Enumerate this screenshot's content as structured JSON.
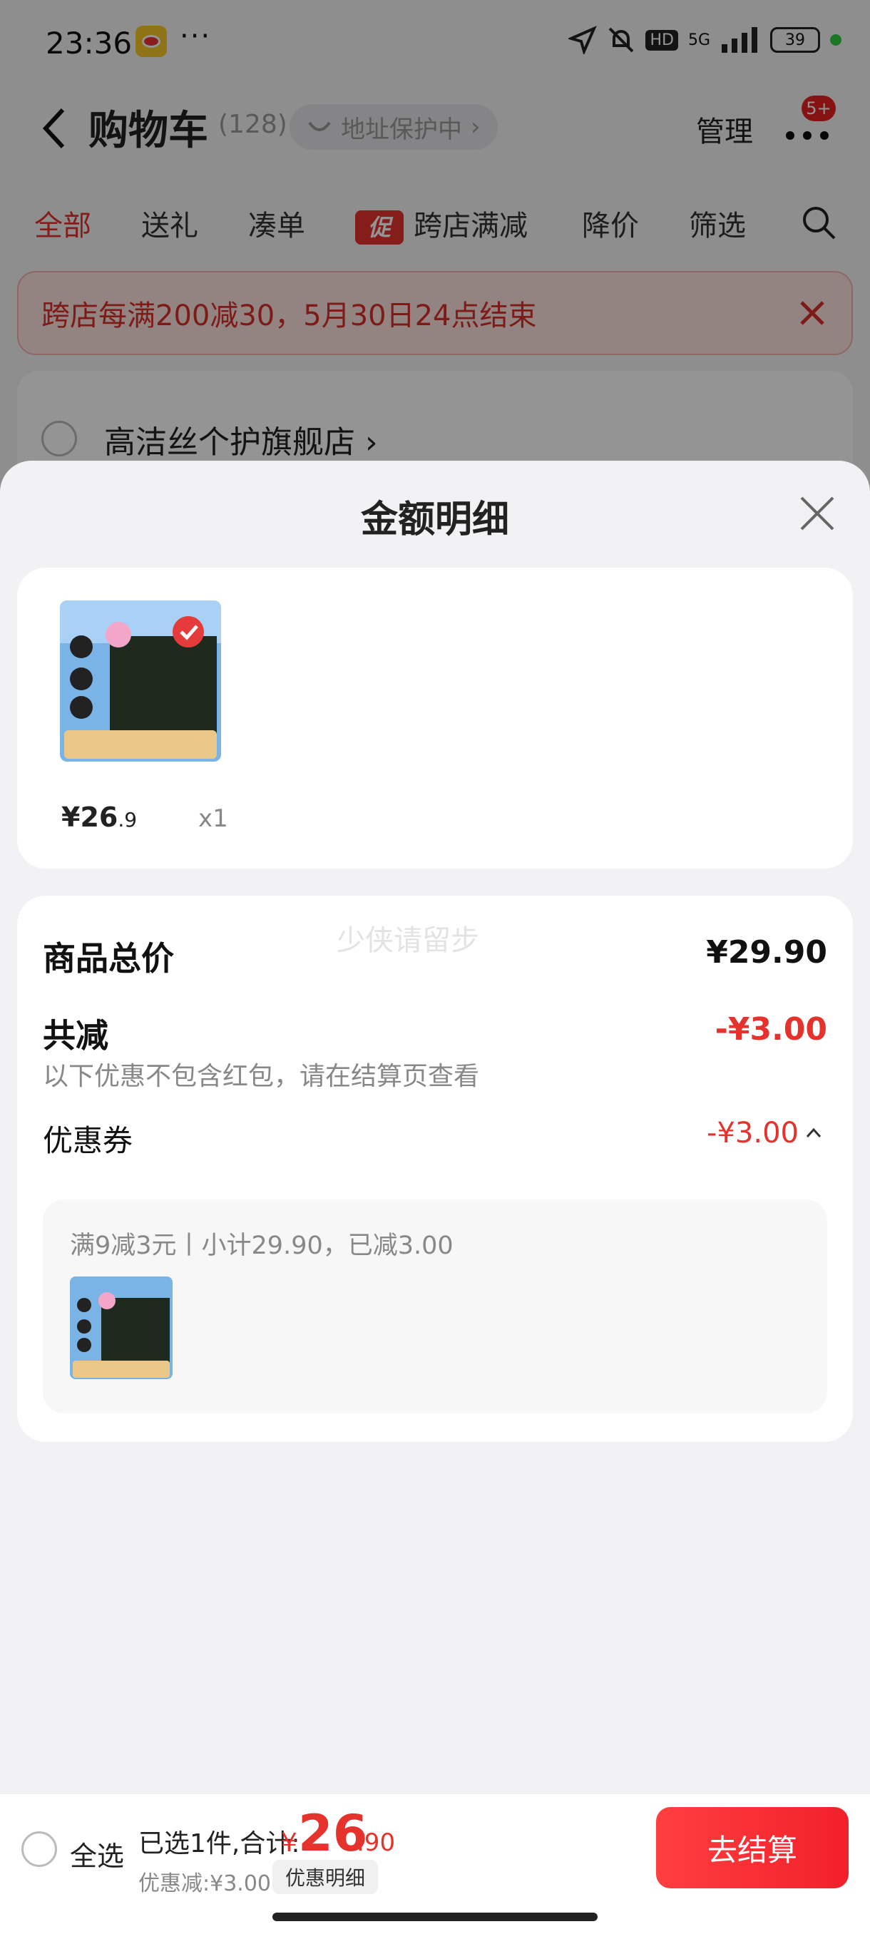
{
  "status_bar": {
    "time": "23:36",
    "more": "···",
    "battery": "39",
    "network": "5G"
  },
  "nav": {
    "title": "购物车",
    "count": "(128)",
    "address_status": "地址保护中",
    "manage": "管理",
    "more_badge": "5+"
  },
  "tabs": [
    {
      "label": "全部",
      "active": true
    },
    {
      "label": "送礼"
    },
    {
      "label": "凑单"
    },
    {
      "label": "跨店满减",
      "tag": "促"
    },
    {
      "label": "降价"
    },
    {
      "label": "筛选"
    }
  ],
  "banner": {
    "text": "跨店每满200减30，5月30日24点结束"
  },
  "store": {
    "name": "高洁丝个护旗舰店"
  },
  "sheet": {
    "title": "金额明细",
    "item": {
      "price_int": "¥26",
      "price_dec": ".9",
      "qty": "x1"
    },
    "summary": {
      "watermark": "少侠请留步",
      "total_label": "商品总价",
      "total_value": "¥29.90",
      "discount_label": "共减",
      "discount_value": "-¥3.00",
      "note": "以下优惠不包含红包，请在结算页查看",
      "coupon_label": "优惠券",
      "coupon_value": "-¥3.00",
      "coupon_desc": "满9减3元丨小计29.90，已减3.00"
    }
  },
  "bottom_bar": {
    "select_all": "全选",
    "selected_text": "已选1件,合计:",
    "total_yen": "¥",
    "total_int": "26",
    "total_dec": ".90",
    "discount_text": "优惠减:¥3.00",
    "detail_button": "优惠明细",
    "checkout": "去结算"
  },
  "colors": {
    "accent": "#e5322d",
    "checkout": "#f1202a"
  }
}
